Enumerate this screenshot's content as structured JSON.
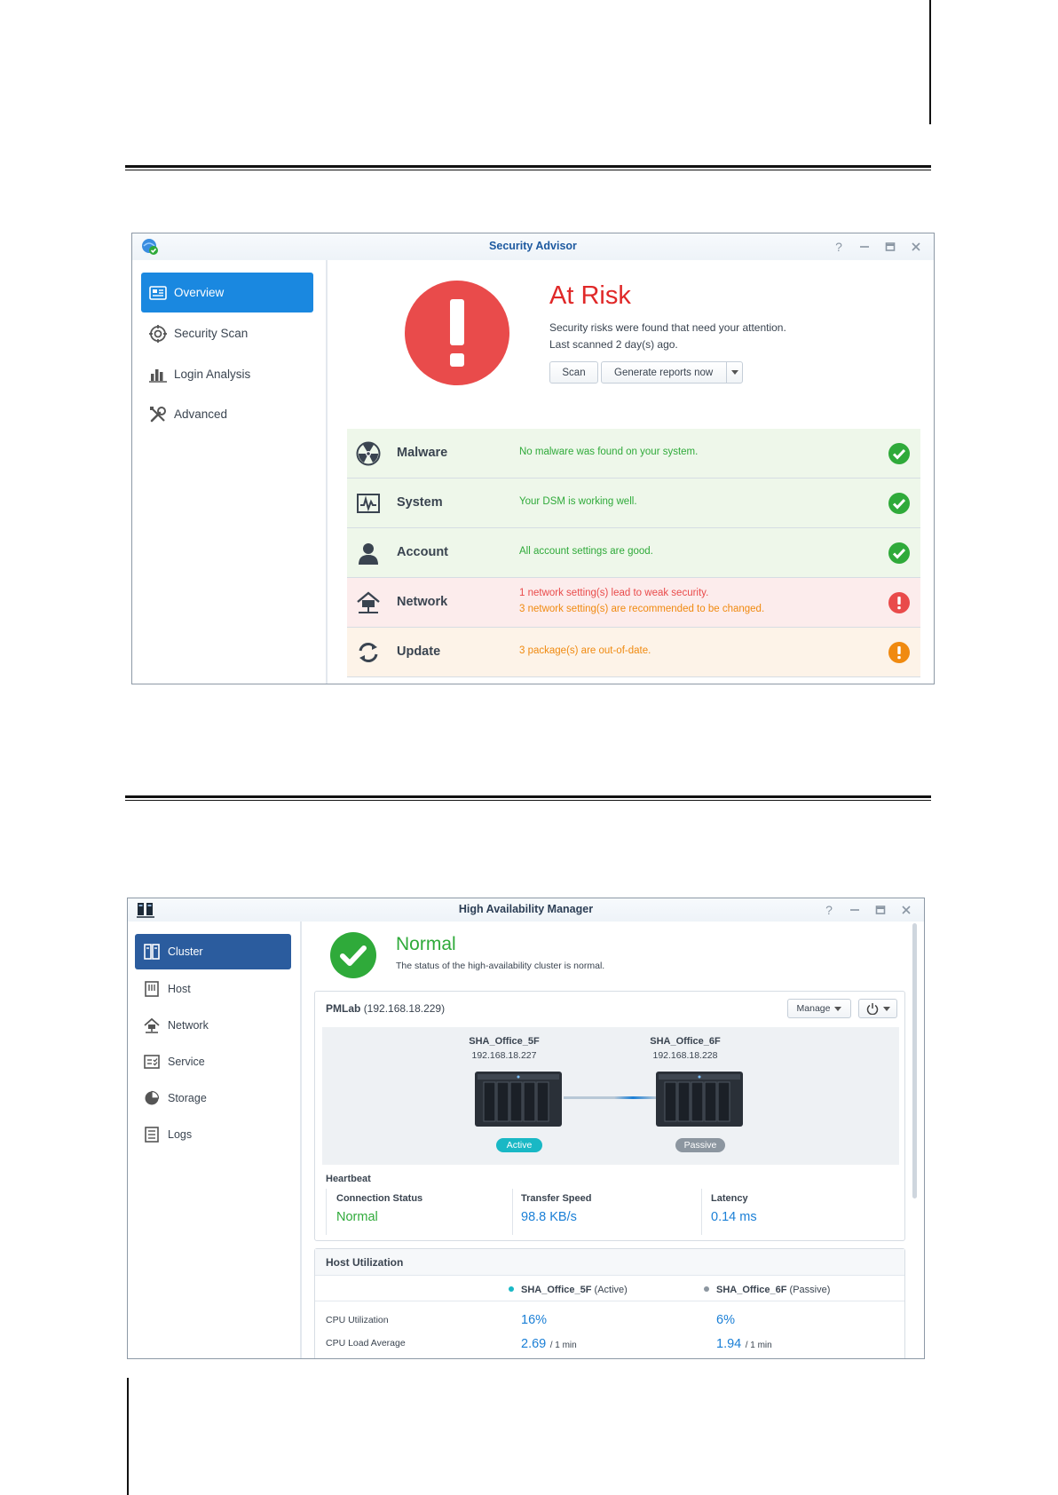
{
  "security_advisor": {
    "window_title": "Security Advisor",
    "sidebar": [
      {
        "label": "Overview",
        "icon": "overview-icon",
        "active": true
      },
      {
        "label": "Security Scan",
        "icon": "target-icon",
        "active": false
      },
      {
        "label": "Login Analysis",
        "icon": "bar-chart-icon",
        "active": false
      },
      {
        "label": "Advanced",
        "icon": "tools-icon",
        "active": false
      }
    ],
    "status": {
      "title": "At Risk",
      "line1": "Security risks were found that need your attention.",
      "line2": "Last scanned 2 day(s) ago."
    },
    "buttons": {
      "scan": "Scan",
      "generate": "Generate reports now"
    },
    "categories": [
      {
        "name": "Malware",
        "icon": "radiation-icon",
        "msg1": "No malware was found on your system.",
        "msg2": "",
        "status": "ok"
      },
      {
        "name": "System",
        "icon": "pulse-monitor-icon",
        "msg1": "Your DSM is working well.",
        "msg2": "",
        "status": "ok"
      },
      {
        "name": "Account",
        "icon": "user-icon",
        "msg1": "All account settings are good.",
        "msg2": "",
        "status": "ok"
      },
      {
        "name": "Network",
        "icon": "network-home-icon",
        "msg1": "1 network setting(s) lead to weak security.",
        "msg2": "3 network setting(s) are recommended to be changed.",
        "status": "risk"
      },
      {
        "name": "Update",
        "icon": "refresh-icon",
        "msg1": "3 package(s) are out-of-date.",
        "msg2": "",
        "status": "warning"
      }
    ],
    "colors": {
      "accent": "#1a88e0",
      "risk": "#e94b4b",
      "ok": "#2faa3a",
      "warning": "#f08a10",
      "ok_bg": "#eef7ea",
      "risk_bg": "#fcecec",
      "warn_bg": "#fdf3e8"
    }
  },
  "ha_manager": {
    "window_title": "High Availability Manager",
    "sidebar": [
      {
        "label": "Cluster",
        "icon": "cluster-icon",
        "active": true
      },
      {
        "label": "Host",
        "icon": "host-icon",
        "active": false
      },
      {
        "label": "Network",
        "icon": "network-home-icon",
        "active": false
      },
      {
        "label": "Service",
        "icon": "service-checklist-icon",
        "active": false
      },
      {
        "label": "Storage",
        "icon": "pie-chart-icon",
        "active": false
      },
      {
        "label": "Logs",
        "icon": "logs-list-icon",
        "active": false
      }
    ],
    "status": {
      "title": "Normal",
      "desc": "The status of the high-availability cluster is normal."
    },
    "cluster": {
      "name": "PMLab",
      "ip": "(192.168.18.229)",
      "manage_label": "Manage"
    },
    "hosts": [
      {
        "name": "SHA_Office_5F",
        "ip": "192.168.18.227",
        "role": "Active"
      },
      {
        "name": "SHA_Office_6F",
        "ip": "192.168.18.228",
        "role": "Passive"
      }
    ],
    "heartbeat": {
      "title": "Heartbeat",
      "connection_label": "Connection Status",
      "connection_value": "Normal",
      "speed_label": "Transfer Speed",
      "speed_value": "98.8 KB/s",
      "latency_label": "Latency",
      "latency_value": "0.14 ms"
    },
    "utilization": {
      "title": "Host Utilization",
      "col1_name": "SHA_Office_5F",
      "col1_role": "(Active)",
      "col2_name": "SHA_Office_6F",
      "col2_role": "(Passive)",
      "rows": [
        {
          "label": "CPU Utilization",
          "v1": "16%",
          "u1": "",
          "v2": "6%",
          "u2": ""
        },
        {
          "label": "CPU Load Average",
          "v1": "2.69",
          "u1": "/ 1 min",
          "v2": "1.94",
          "u2": "/ 1 min"
        }
      ]
    },
    "colors": {
      "accent": "#2b5c9e",
      "ok": "#2faa3a",
      "active_pill": "#19b8c5",
      "passive_pill": "#8c96a0",
      "value": "#1a7fd6"
    }
  }
}
